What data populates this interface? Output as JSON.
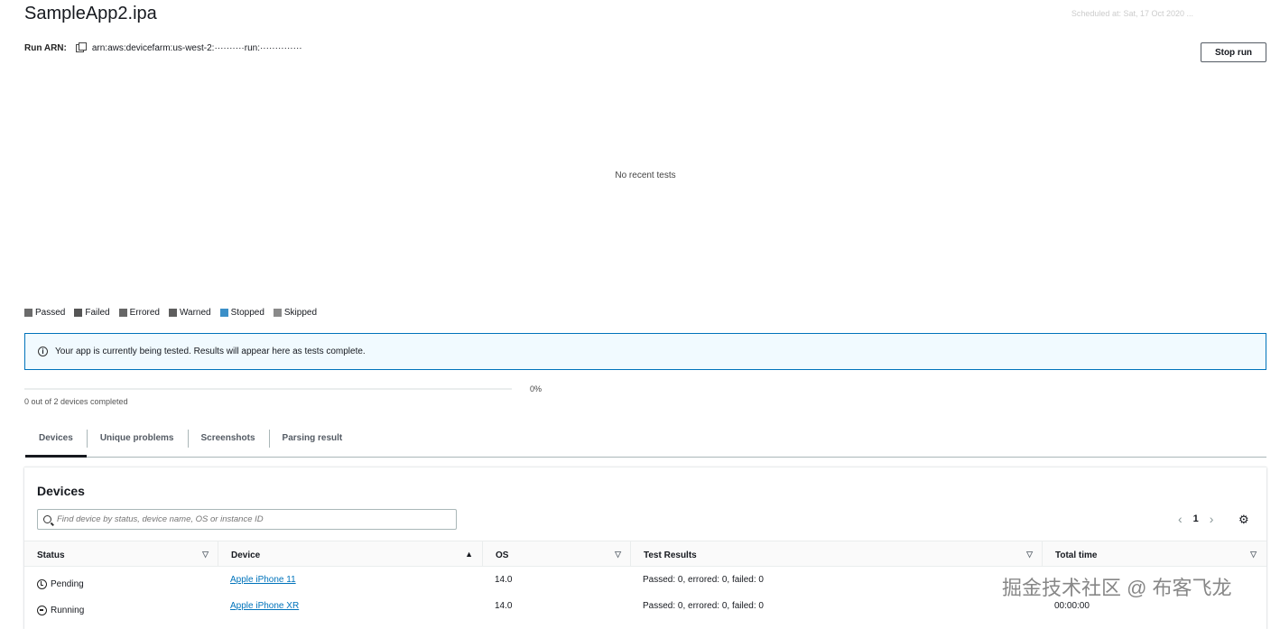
{
  "header": {
    "title": "SampleApp2.ipa",
    "scheduled": "Scheduled at: Sat, 17 Oct 2020 ...",
    "arn_label": "Run ARN:",
    "arn_value": "arn:aws:devicefarm:us-west-2:··········run:··············",
    "stop_button": "Stop run"
  },
  "chart": {
    "empty_message": "No recent tests"
  },
  "legend": {
    "items": [
      {
        "label": "Passed",
        "color": "#6b6b6b"
      },
      {
        "label": "Failed",
        "color": "#555555"
      },
      {
        "label": "Errored",
        "color": "#666666"
      },
      {
        "label": "Warned",
        "color": "#5e5e5e"
      },
      {
        "label": "Stopped",
        "color": "#3b8fc8"
      },
      {
        "label": "Skipped",
        "color": "#8a8a8a"
      }
    ]
  },
  "alert": {
    "icon": "info-icon",
    "message": "Your app is currently being tested. Results will appear here as tests complete."
  },
  "progress": {
    "percent_label": "0%",
    "fraction": 0,
    "devices_completed": "0 out of 2 devices completed"
  },
  "tabs": [
    {
      "label": "Devices",
      "active": true
    },
    {
      "label": "Unique problems",
      "active": false
    },
    {
      "label": "Screenshots",
      "active": false
    },
    {
      "label": "Parsing result",
      "active": false
    }
  ],
  "devices": {
    "title": "Devices",
    "search_placeholder": "Find device by status, device name, OS or instance ID",
    "page": "1",
    "columns": [
      "Status",
      "Device",
      "OS",
      "Test Results",
      "Total time"
    ],
    "rows": [
      {
        "status": "Pending",
        "device": "Apple iPhone 11",
        "os": "14.0",
        "results": "Passed: 0, errored: 0, failed: 0",
        "time": ""
      },
      {
        "status": "Running",
        "device": "Apple iPhone XR",
        "os": "14.0",
        "results": "Passed: 0, errored: 0, failed: 0",
        "time": "00:00:00"
      }
    ]
  },
  "watermark": "掘金技术社区 @ 布客飞龙"
}
